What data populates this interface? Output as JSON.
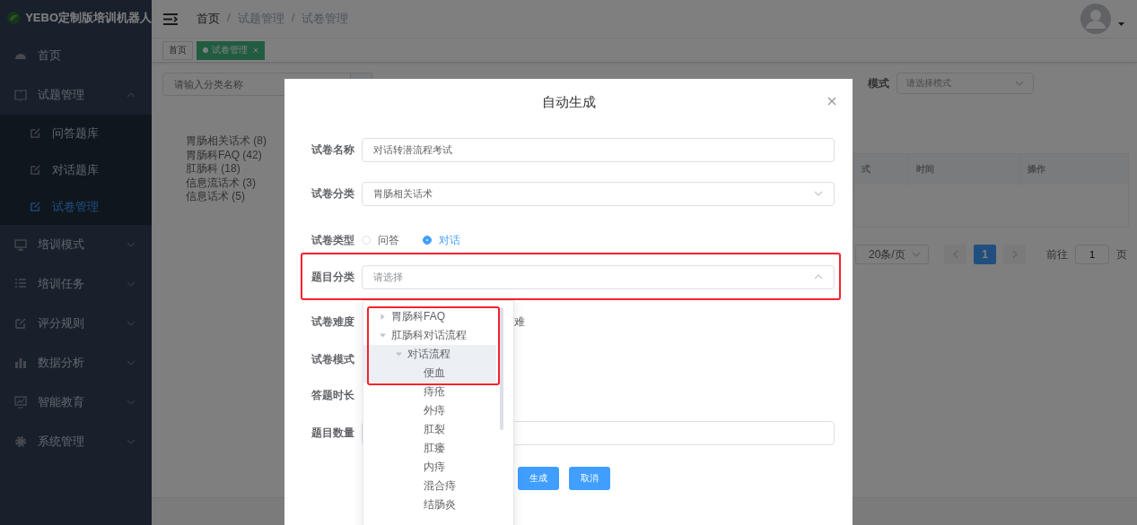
{
  "sidebar": {
    "logo_text": "YEBO定制版培训机器人",
    "items": [
      {
        "label": "首页",
        "kind": "item",
        "selected": false
      },
      {
        "label": "试题管理",
        "kind": "submenu",
        "expanded": true,
        "selected": false,
        "children": [
          {
            "label": "问答题库",
            "selected": false
          },
          {
            "label": "对话题库",
            "selected": false
          },
          {
            "label": "试卷管理",
            "selected": true
          }
        ]
      },
      {
        "label": "培训模式",
        "kind": "submenu",
        "expanded": false,
        "selected": false
      },
      {
        "label": "培训任务",
        "kind": "submenu",
        "expanded": false,
        "selected": false
      },
      {
        "label": "评分规则",
        "kind": "submenu",
        "expanded": false,
        "selected": false
      },
      {
        "label": "数据分析",
        "kind": "submenu",
        "expanded": false,
        "selected": false
      },
      {
        "label": "智能教育",
        "kind": "submenu",
        "expanded": false,
        "selected": false
      },
      {
        "label": "系统管理",
        "kind": "submenu",
        "expanded": false,
        "selected": false
      }
    ]
  },
  "header": {
    "breadcrumb": [
      "首页",
      "试题管理",
      "试卷管理"
    ],
    "separator": "/"
  },
  "tags": [
    {
      "label": "首页",
      "selected": false,
      "closable": false
    },
    {
      "label": "试卷管理",
      "selected": true,
      "closable": true
    }
  ],
  "category_panel": {
    "search_placeholder": "请输入分类名称",
    "categories": [
      "胃肠相关话术 (8)",
      "胃肠科FAQ (42)",
      "肛肠科 (18)",
      "信息流话术 (3)",
      "信息话术 (5)"
    ]
  },
  "filters": {
    "mode_label": "模式",
    "mode_placeholder": "请选择模式"
  },
  "table": {
    "columns": [
      "式",
      "时间",
      "操作"
    ]
  },
  "pagination": {
    "page_size": "20条/页",
    "pages": [
      {
        "label": "1",
        "selected": true
      }
    ],
    "goto_label": "前往",
    "goto_value": "1",
    "page_suffix": "页"
  },
  "dialog": {
    "title": "自动生成",
    "fields": [
      {
        "label": "试卷名称",
        "kind": "input",
        "value": "对话转潜流程考试"
      },
      {
        "label": "试卷分类",
        "kind": "select",
        "value": "胃肠相关话术"
      },
      {
        "label": "试卷类型",
        "kind": "radio",
        "options": [
          {
            "label": "问答",
            "selected": false
          },
          {
            "label": "对话",
            "selected": true
          }
        ]
      },
      {
        "label": "题目分类",
        "kind": "tree-select",
        "placeholder": "请选择",
        "open": true,
        "annotated": true
      },
      {
        "label": "试卷难度",
        "kind": "covered",
        "visible_text": "难"
      },
      {
        "label": "试卷模式",
        "kind": "covered"
      },
      {
        "label": "答题时长",
        "kind": "covered"
      },
      {
        "label": "题目数量",
        "kind": "input"
      }
    ],
    "dropdown": {
      "framed": true,
      "nodes": [
        {
          "label": "胃肠科FAQ",
          "expanded": false,
          "highlighted": false
        },
        {
          "label": "肛肠科对话流程",
          "expanded": true,
          "highlighted": false,
          "children": [
            {
              "label": "对话流程",
              "expanded": true,
              "highlighted": true,
              "children": [
                {
                  "label": "便血",
                  "highlighted": true
                },
                {
                  "label": "痔疮",
                  "highlighted": false
                },
                {
                  "label": "外痔",
                  "highlighted": false
                },
                {
                  "label": "肛裂",
                  "highlighted": false
                },
                {
                  "label": "肛瘘",
                  "highlighted": false
                },
                {
                  "label": "内痔",
                  "highlighted": false
                },
                {
                  "label": "混合痔",
                  "highlighted": false
                },
                {
                  "label": "结肠炎",
                  "highlighted": false
                }
              ]
            }
          ]
        }
      ]
    },
    "buttons": [
      "生成",
      "取消"
    ]
  }
}
